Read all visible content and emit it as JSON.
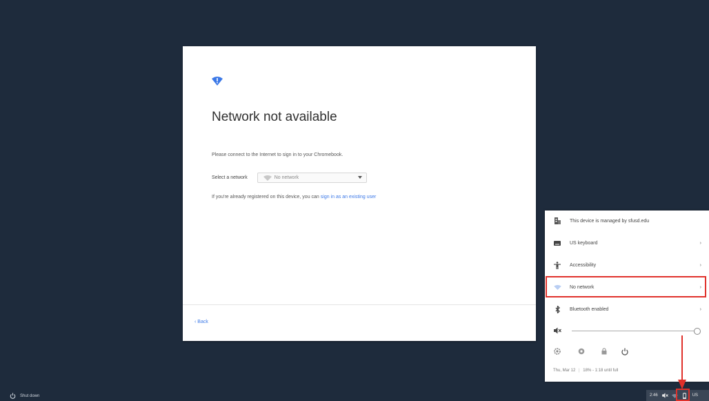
{
  "dialog": {
    "icon": "wifi-alert-icon",
    "title": "Network not available",
    "description": "Please connect to the Internet to sign in to your Chromebook.",
    "select_label": "Select a network",
    "select_value": "No network",
    "registered_text": "If you're already registered on this device, you can",
    "registered_link": "sign in as an existing user",
    "back_label": "Back"
  },
  "tray": {
    "managed": "This device is managed by sfusd.edu",
    "keyboard": "US keyboard",
    "accessibility": "Accessibility",
    "network": "No network",
    "bluetooth": "Bluetooth enabled",
    "date": "Thu, Mar 12",
    "battery": "18% - 1:18 until full",
    "icons": [
      "building-icon",
      "keyboard-icon",
      "accessibility-icon",
      "wifi-icon",
      "bluetooth-icon",
      "volume-muted-icon",
      "settings-icon",
      "help-icon",
      "lock-icon",
      "power-icon"
    ]
  },
  "shelf": {
    "shutdown_label": "Shut down",
    "time": "2:46",
    "lang": "US"
  },
  "colors": {
    "background": "#1e2b3c",
    "accent": "#3b78e7",
    "highlight": "#e0302a"
  }
}
